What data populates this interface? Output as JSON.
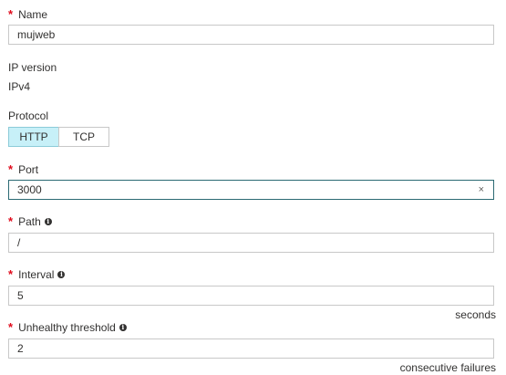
{
  "name": {
    "label": "Name",
    "required_mark": "*",
    "value": "mujweb"
  },
  "ip_version": {
    "label": "IP version",
    "value": "IPv4"
  },
  "protocol": {
    "label": "Protocol",
    "options": [
      "HTTP",
      "TCP"
    ],
    "selected": "HTTP"
  },
  "port": {
    "label": "Port",
    "required_mark": "*",
    "value": "3000",
    "clear_glyph": "×"
  },
  "path": {
    "label": "Path",
    "required_mark": "*",
    "value": "/",
    "info_glyph": "i"
  },
  "interval": {
    "label": "Interval",
    "required_mark": "*",
    "value": "5",
    "info_glyph": "i",
    "unit": "seconds"
  },
  "unhealthy_threshold": {
    "label": "Unhealthy threshold",
    "required_mark": "*",
    "value": "2",
    "info_glyph": "i",
    "unit": "consecutive failures"
  },
  "colors": {
    "required": "#e00b1c",
    "active_segment": "#c7f0f8",
    "focus_border": "#2b6a73"
  }
}
